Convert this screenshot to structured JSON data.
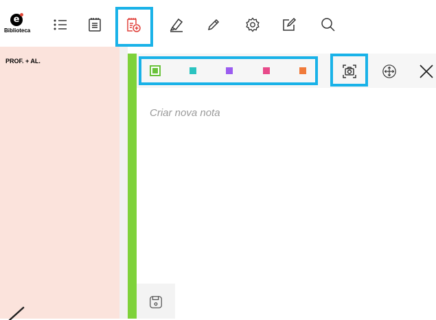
{
  "logo": {
    "letter": "e",
    "label": "Biblioteca"
  },
  "toolbar": {
    "icons": [
      "list-icon",
      "notes-list-icon",
      "add-note-icon",
      "highlighter-icon",
      "pencil-icon",
      "gear-icon",
      "edit-icon",
      "search-icon"
    ],
    "active": "add-note-icon",
    "active_color": "#e0403a",
    "highlight_color": "#19b2e8"
  },
  "left_panel": {
    "label": "PROF. + AL.",
    "background": "#fbe3dc"
  },
  "note": {
    "accent_color": "#7ed23a",
    "colors": [
      "#69c23a",
      "#2bc3c0",
      "#9b5cf0",
      "#e84a8a",
      "#f07a3a"
    ],
    "selected_color": "#69c23a",
    "placeholder": "Criar nova nota"
  }
}
